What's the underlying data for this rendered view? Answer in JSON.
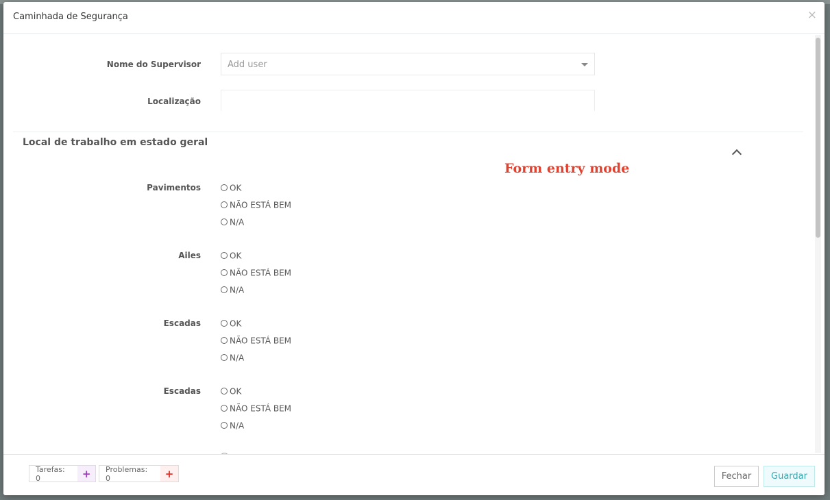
{
  "modal": {
    "title": "Caminhada de Segurança",
    "close_glyph": "×"
  },
  "form": {
    "supervisor_label": "Nome do Supervisor",
    "supervisor_placeholder": "Add user",
    "location_label": "Localização",
    "location_value": ""
  },
  "section": {
    "title": "Local de trabalho em estado geral",
    "mode_note": "Form entry mode"
  },
  "groups": [
    {
      "label": "Pavimentos",
      "options": [
        "OK",
        "NÃO ESTÁ BEM",
        "N/A"
      ]
    },
    {
      "label": "Ailes",
      "options": [
        "OK",
        "NÃO ESTÁ BEM",
        "N/A"
      ]
    },
    {
      "label": "Escadas",
      "options": [
        "OK",
        "NÃO ESTÁ BEM",
        "N/A"
      ]
    },
    {
      "label": "Escadas",
      "options": [
        "OK",
        "NÃO ESTÁ BEM",
        "N/A"
      ]
    }
  ],
  "footer": {
    "tasks_label": "Tarefas: 0",
    "problems_label": "Problemas: 0",
    "tasks_add_glyph": "+",
    "problems_add_glyph": "+",
    "close_label": "Fechar",
    "save_label": "Guardar"
  },
  "colors": {
    "tasks_accent": "#9b3fbf",
    "problems_accent": "#e0302a",
    "mode_note": "#e0422f",
    "save_text": "#3aa7ae"
  }
}
